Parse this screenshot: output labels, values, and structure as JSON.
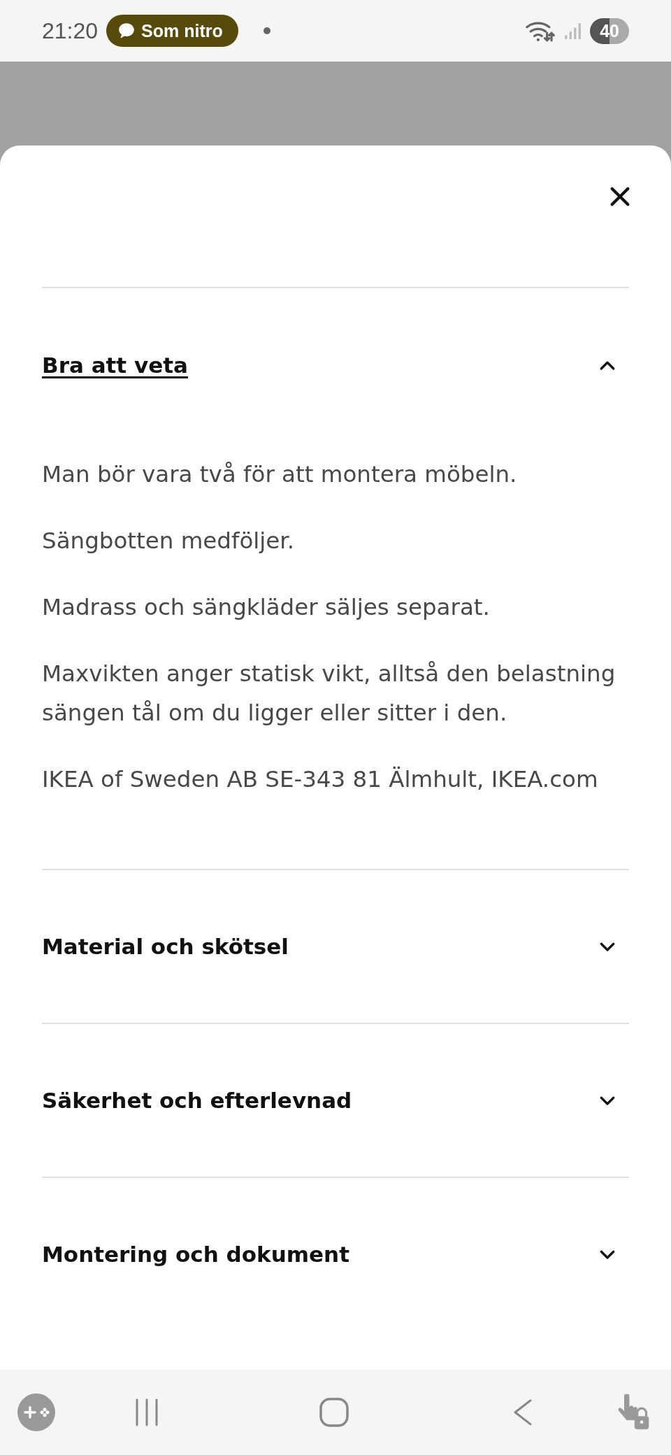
{
  "status_bar": {
    "time": "21:20",
    "notification": "Som nitro",
    "battery": "40"
  },
  "sections": [
    {
      "title": "Bra att veta",
      "expanded": true,
      "paragraphs": [
        "Man bör vara två för att montera möbeln.",
        "Sängbotten medföljer.",
        "Madrass och sängkläder säljes separat.",
        "Maxvikten anger statisk vikt, alltså den belastning sängen tål om du ligger eller sitter i den.",
        "IKEA of Sweden AB SE-343 81 Älmhult, IKEA.com"
      ]
    },
    {
      "title": "Material och skötsel",
      "expanded": false
    },
    {
      "title": "Säkerhet och efterlevnad",
      "expanded": false
    },
    {
      "title": "Montering och dokument",
      "expanded": false
    }
  ]
}
